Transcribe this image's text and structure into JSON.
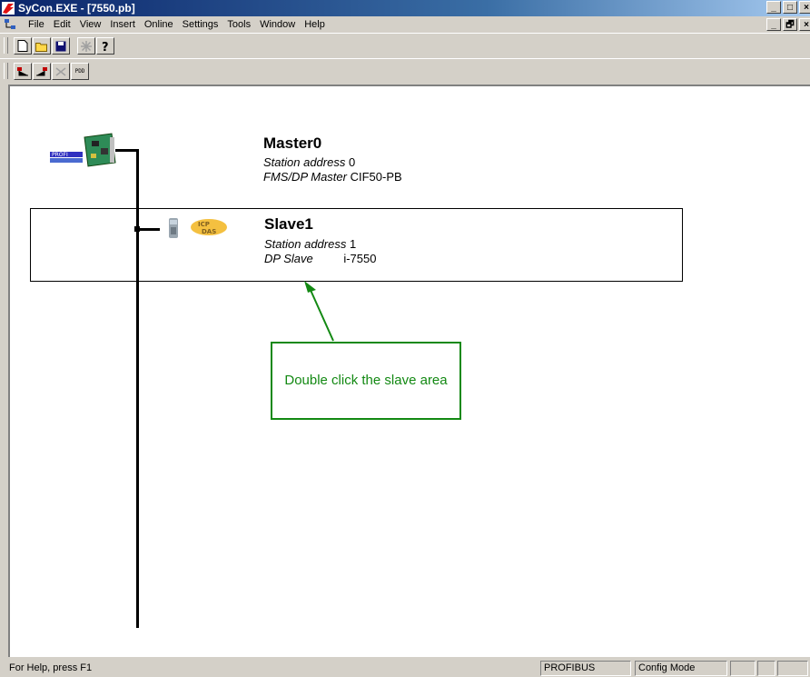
{
  "window": {
    "title": "SyCon.EXE - [7550.pb]",
    "controls": {
      "minimize": "_",
      "maximize": "□",
      "close": "×",
      "restore": "🗗"
    }
  },
  "menu": {
    "items": [
      "File",
      "Edit",
      "View",
      "Insert",
      "Online",
      "Settings",
      "Tools",
      "Window",
      "Help"
    ]
  },
  "toolbar2": {
    "pdd_label": "PDD"
  },
  "network": {
    "master": {
      "name": "Master0",
      "station_label": "Station address",
      "station_value": "0",
      "type_label": "FMS/DP Master",
      "type_value": "CIF50-PB"
    },
    "slave": {
      "name": "Slave1",
      "station_label": "Station address",
      "station_value": "1",
      "type_label": "DP Slave",
      "type_value": "i-7550"
    }
  },
  "callout": {
    "text": "Double click the slave area"
  },
  "status": {
    "help": "For Help, press F1",
    "bus": "PROFIBUS",
    "mode": "Config Mode"
  },
  "colors": {
    "titlebar_start": "#0a246a",
    "callout_green": "#138913",
    "face": "#d4d0c8"
  }
}
